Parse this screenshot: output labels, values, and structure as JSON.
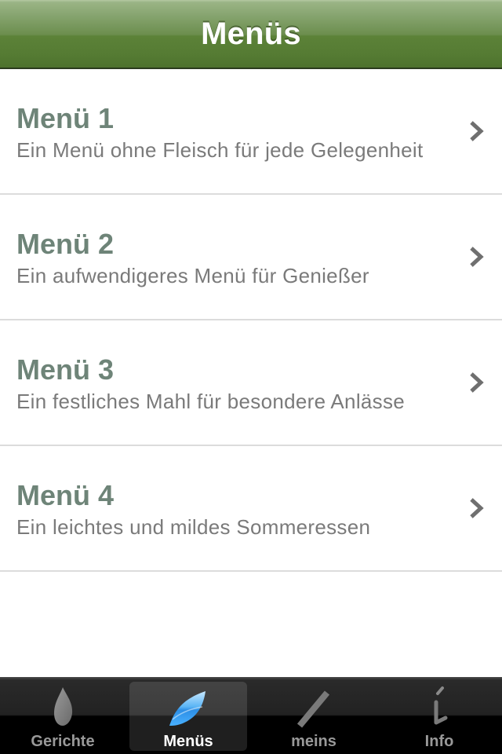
{
  "navbar": {
    "title": "Menüs"
  },
  "menus": [
    {
      "title": "Menü 1",
      "subtitle": "Ein Menü ohne Fleisch für jede Gelegenheit"
    },
    {
      "title": "Menü 2",
      "subtitle": "Ein aufwendigeres Menü für Genießer"
    },
    {
      "title": "Menü 3",
      "subtitle": "Ein festliches Mahl für besondere Anlässe"
    },
    {
      "title": "Menü 4",
      "subtitle": "Ein leichtes und mildes Sommeressen"
    }
  ],
  "tabbar": {
    "tabs": [
      {
        "label": "Gerichte",
        "icon": "leaf-drop-icon",
        "active": false
      },
      {
        "label": "Menüs",
        "icon": "leaf-icon",
        "active": true
      },
      {
        "label": "meins",
        "icon": "pen-stroke-icon",
        "active": false
      },
      {
        "label": "Info",
        "icon": "info-icon",
        "active": false
      }
    ]
  },
  "colors": {
    "navbar_green": "#5c8238",
    "title_text": "#6e8478",
    "subtitle_text": "#7a7a7a",
    "active_icon_blue": "#3aa0f0"
  }
}
